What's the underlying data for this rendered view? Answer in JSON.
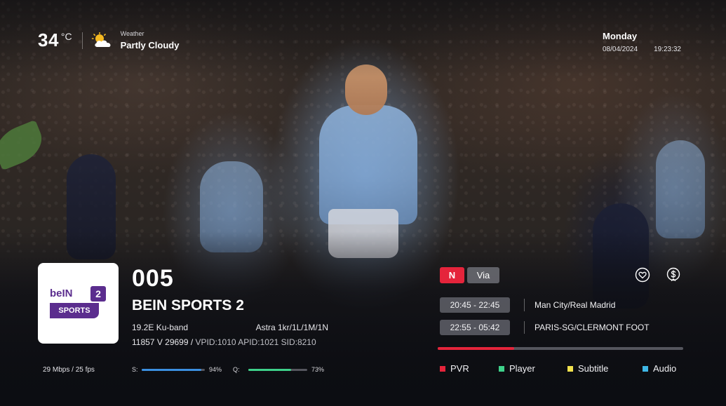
{
  "weather": {
    "temperature": "34",
    "unit": "°C",
    "label": "Weather",
    "condition": "Partly Cloudy",
    "icon": "partly-cloudy-icon"
  },
  "clock": {
    "day": "Monday",
    "date": "08/04/2024",
    "time": "19:23:32"
  },
  "channel": {
    "logo": {
      "word": "beIN",
      "badge": "2",
      "sports": "SPORTS"
    },
    "number": "005",
    "name": "BEIN SPORTS 2",
    "band": "19.2E Ku-band",
    "satellite": "Astra 1kr/1L/1M/1N",
    "transponder": "11857 V 29699 /",
    "pids": "VPID:1010  APID:1021  SID:8210"
  },
  "status": {
    "bitrate": "29 Mbps / 25 fps",
    "signal": {
      "label": "S:",
      "percent": 94,
      "text": "94%",
      "color": "#3b8fe0"
    },
    "quality": {
      "label": "Q:",
      "percent": 73,
      "text": "73%",
      "color": "#3ed18a"
    }
  },
  "badges": {
    "new": "N",
    "via": "Via"
  },
  "icons": {
    "favorite": "heart-icon",
    "pay": "dollar-icon"
  },
  "epg": {
    "events": [
      {
        "time": "20:45 - 22:45",
        "title": "Man City/Real Madrid"
      },
      {
        "time": "22:55 - 05:42",
        "title": "PARIS-SG/CLERMONT FOOT"
      }
    ],
    "progress_percent": 31
  },
  "color_keys": [
    {
      "label": "PVR",
      "color": "#e5243b"
    },
    {
      "label": "Player",
      "color": "#3ed18a"
    },
    {
      "label": "Subtitle",
      "color": "#f2e24d"
    },
    {
      "label": "Audio",
      "color": "#3fb7e6"
    }
  ],
  "colors": {
    "accent": "#e5243b",
    "brand": "#5b2d8e"
  }
}
